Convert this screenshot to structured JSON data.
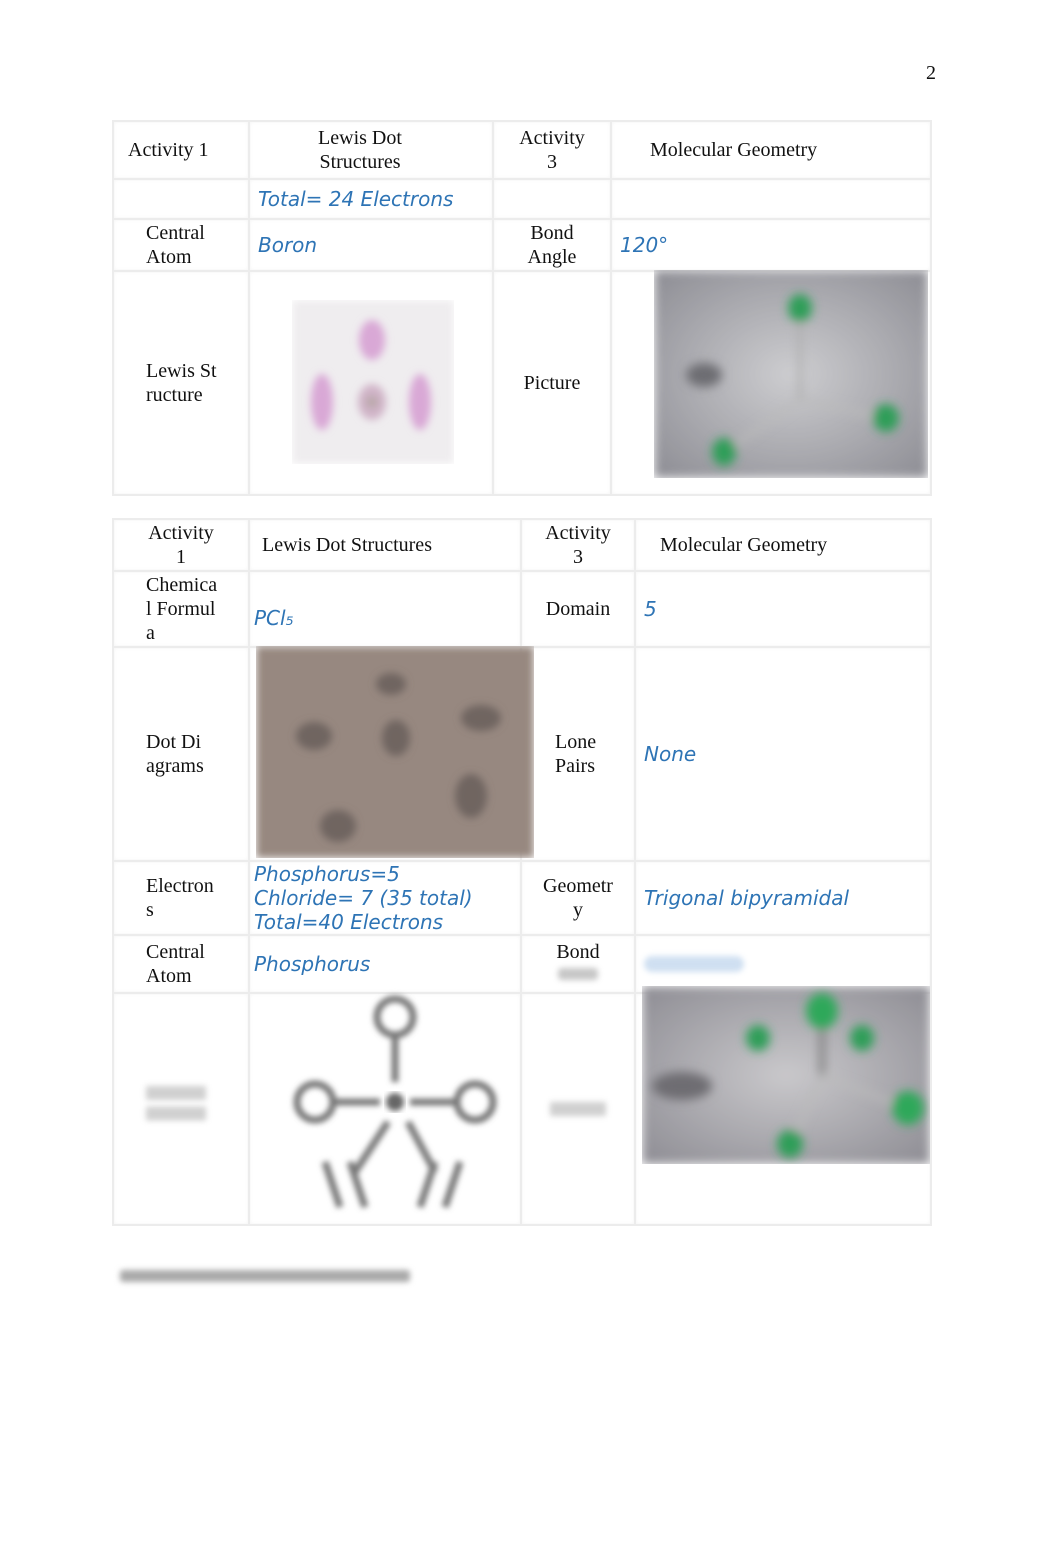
{
  "page_number": "2",
  "table1": {
    "header": {
      "activity1": "Activity 1",
      "lewis_title": "Lewis Dot Structures",
      "activity3": "Activity 3",
      "geometry_title": "Molecular Geometry"
    },
    "total_electrons": "Total= 24 Electrons",
    "central_atom_label": "Central Atom",
    "central_atom_value": "Boron",
    "bond_angle_label": "Bond Angle",
    "bond_angle_value": "120°",
    "lewis_structure_label": "Lewis Structure",
    "lewis_structure_image": "BF3 Lewis dot structure drawing (pink)",
    "picture_label": "Picture",
    "picture_image": "Trigonal planar molecular model photo (green atoms)"
  },
  "table2": {
    "header": {
      "activity1": "Activity 1",
      "lewis_title": "Lewis Dot Structures",
      "activity3": "Activity 3",
      "geometry_title": "Molecular Geometry"
    },
    "chemical_formula_label": "Chemical Formula",
    "chemical_formula_value": "PCl₅",
    "domain_label": "Domain",
    "domain_value": "5",
    "dot_diagrams_label": "Dot Diagrams",
    "dot_diagrams_image": "Hand-drawn dot diagrams photo",
    "lone_pairs_label": "Lone Pairs",
    "lone_pairs_value": "None",
    "electrons_label": "Electrons",
    "electrons_lines": [
      "Phosphorus=5",
      "Chloride= 7 (35 total)",
      "Total=40 Electrons"
    ],
    "geometry_label": "Geometry",
    "geometry_value": "Trigonal bipyramidal",
    "central_atom_label": "Central Atom",
    "central_atom_value": "Phosphorus",
    "bond_angle_label": "Bond",
    "lewis_structure_image": "PCl5 Lewis structure drawing",
    "picture_image": "Trigonal bipyramidal molecular model photo (green atoms)"
  },
  "colors": {
    "answer_text": "#2e74b5",
    "model_atom": "#2fa85a"
  }
}
